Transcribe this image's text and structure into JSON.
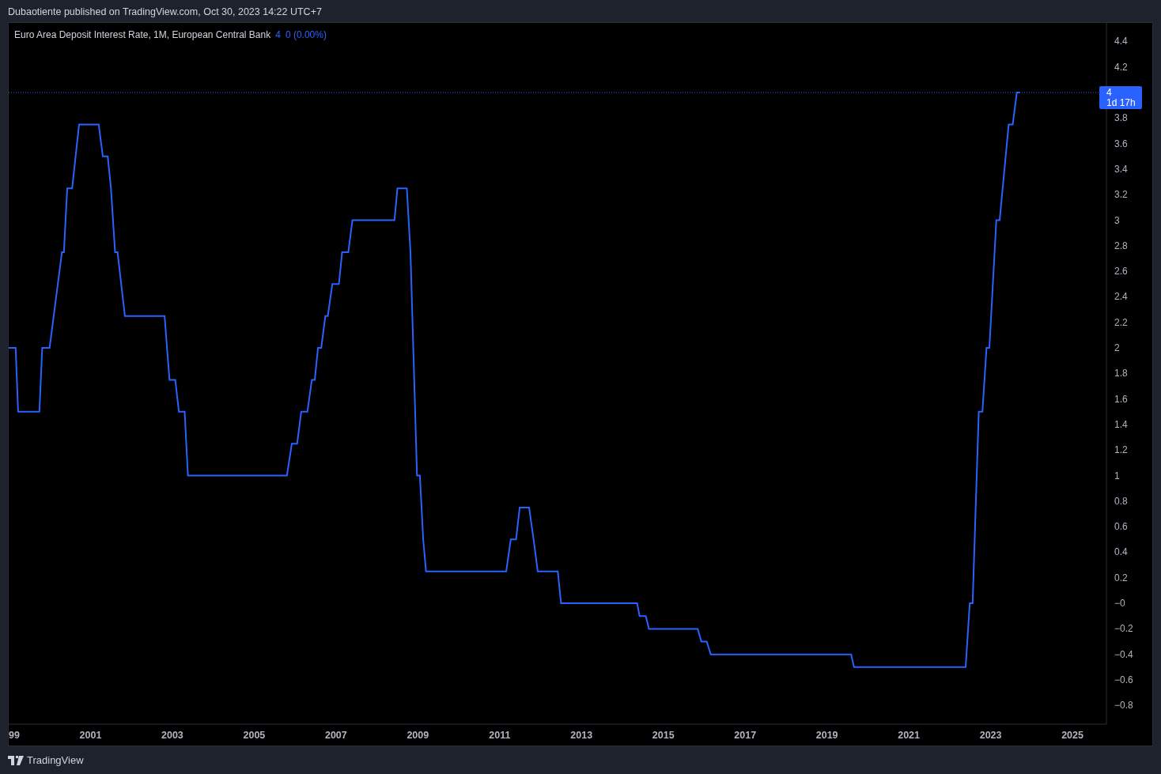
{
  "header": {
    "text": "Dubaotiente published on TradingView.com, Oct 30, 2023 14:22 UTC+7"
  },
  "legend": {
    "title_suffix": ", 1M, European Central Bank",
    "value": "4",
    "change": "0 (0.00%)"
  },
  "price_label": {
    "value": "4",
    "countdown": "1d 17h"
  },
  "chart_data": {
    "type": "line",
    "xlim": [
      1999,
      2025.83
    ],
    "ylim": [
      -0.947,
      4.545
    ],
    "xticks": [
      {
        "value": 1999,
        "label": "99"
      },
      {
        "value": 2001,
        "label": "2001"
      },
      {
        "value": 2003,
        "label": "2003"
      },
      {
        "value": 2005,
        "label": "2005"
      },
      {
        "value": 2007,
        "label": "2007"
      },
      {
        "value": 2009,
        "label": "2009"
      },
      {
        "value": 2011,
        "label": "2011"
      },
      {
        "value": 2013,
        "label": "2013"
      },
      {
        "value": 2015,
        "label": "2015"
      },
      {
        "value": 2017,
        "label": "2017"
      },
      {
        "value": 2019,
        "label": "2019"
      },
      {
        "value": 2021,
        "label": "2021"
      },
      {
        "value": 2023,
        "label": "2023"
      },
      {
        "value": 2025,
        "label": "2025"
      }
    ],
    "yticks": [
      {
        "value": 4.4,
        "label": "4.4"
      },
      {
        "value": 4.2,
        "label": "4.2"
      },
      {
        "value": 3.8,
        "label": "3.8"
      },
      {
        "value": 3.6,
        "label": "3.6"
      },
      {
        "value": 3.4,
        "label": "3.4"
      },
      {
        "value": 3.2,
        "label": "3.2"
      },
      {
        "value": 3,
        "label": "3"
      },
      {
        "value": 2.8,
        "label": "2.8"
      },
      {
        "value": 2.6,
        "label": "2.6"
      },
      {
        "value": 2.4,
        "label": "2.4"
      },
      {
        "value": 2.2,
        "label": "2.2"
      },
      {
        "value": 2,
        "label": "2"
      },
      {
        "value": 1.8,
        "label": "1.8"
      },
      {
        "value": 1.6,
        "label": "1.6"
      },
      {
        "value": 1.4,
        "label": "1.4"
      },
      {
        "value": 1.2,
        "label": "1.2"
      },
      {
        "value": 1,
        "label": "1"
      },
      {
        "value": 0.8,
        "label": "0.8"
      },
      {
        "value": 0.6,
        "label": "0.6"
      },
      {
        "value": 0.4,
        "label": "0.4"
      },
      {
        "value": 0.2,
        "label": "0.2"
      },
      {
        "value": 0,
        "label": "−0"
      },
      {
        "value": -0.2,
        "label": "−0.2"
      },
      {
        "value": -0.4,
        "label": "−0.4"
      },
      {
        "value": -0.6,
        "label": "−0.6"
      },
      {
        "value": -0.8,
        "label": "−0.8"
      }
    ],
    "x": [
      1999.0,
      1999.17,
      1999.23,
      1999.75,
      1999.82,
      2000.0,
      2000.2,
      2000.3,
      2000.35,
      2000.43,
      2000.55,
      2000.72,
      2001.2,
      2001.3,
      2001.42,
      2001.5,
      2001.6,
      2001.66,
      2001.84,
      2002.81,
      2002.93,
      2003.07,
      2003.16,
      2003.3,
      2003.38,
      2005.8,
      2005.92,
      2006.05,
      2006.15,
      2006.3,
      2006.41,
      2006.48,
      2006.56,
      2006.64,
      2006.74,
      2006.8,
      2006.91,
      2007.07,
      2007.15,
      2007.3,
      2007.4,
      2008.43,
      2008.5,
      2008.73,
      2008.82,
      2008.98,
      2009.05,
      2009.13,
      2009.2,
      2011.16,
      2011.27,
      2011.4,
      2011.49,
      2011.72,
      2011.83,
      2011.93,
      2012.42,
      2012.5,
      2014.36,
      2014.42,
      2014.57,
      2014.65,
      2015.84,
      2015.93,
      2016.06,
      2016.16,
      2019.59,
      2019.66,
      2022.39,
      2022.49,
      2022.56,
      2022.71,
      2022.8,
      2022.9,
      2022.97,
      2023.14,
      2023.22,
      2023.44,
      2023.54,
      2023.64,
      2023.72,
      2025.83
    ],
    "series": [
      {
        "name": "Euro Area Deposit Interest Rate",
        "color": "#2962ff",
        "values": [
          2,
          2,
          1.5,
          1.5,
          2,
          2,
          2.5,
          2.75,
          2.75,
          3.25,
          3.25,
          3.75,
          3.75,
          3.5,
          3.5,
          3.25,
          2.75,
          2.75,
          2.25,
          2.25,
          1.75,
          1.75,
          1.5,
          1.5,
          1,
          1,
          1.25,
          1.25,
          1.5,
          1.5,
          1.75,
          1.75,
          2,
          2,
          2.25,
          2.25,
          2.5,
          2.5,
          2.75,
          2.75,
          3,
          3,
          3.25,
          3.25,
          2.75,
          1,
          1,
          0.5,
          0.25,
          0.25,
          0.5,
          0.5,
          0.75,
          0.75,
          0.5,
          0.25,
          0.25,
          0,
          0,
          -0.1,
          -0.1,
          -0.2,
          -0.2,
          -0.3,
          -0.3,
          -0.4,
          -0.4,
          -0.5,
          -0.5,
          0,
          0,
          1.5,
          1.5,
          2,
          2,
          3,
          3,
          3.75,
          3.75,
          4,
          4,
          null
        ]
      },
      {
        "color": "#2962ff",
        "line_style": "dotted",
        "values": [
          4,
          null,
          null,
          null,
          null,
          null,
          null,
          null,
          null,
          null,
          null,
          null,
          null,
          null,
          null,
          null,
          null,
          null,
          null,
          null,
          null,
          null,
          null,
          null,
          null,
          null,
          null,
          null,
          null,
          null,
          null,
          null,
          null,
          null,
          null,
          null,
          null,
          null,
          null,
          null,
          null,
          null,
          null,
          null,
          null,
          null,
          null,
          null,
          null,
          null,
          null,
          null,
          null,
          null,
          null,
          null,
          null,
          null,
          null,
          null,
          null,
          null,
          null,
          null,
          null,
          null,
          null,
          null,
          null,
          null,
          null,
          null,
          null,
          null,
          null,
          null,
          null,
          null,
          null,
          null,
          4,
          4
        ]
      }
    ]
  },
  "footer": {
    "brand": "TradingView"
  }
}
